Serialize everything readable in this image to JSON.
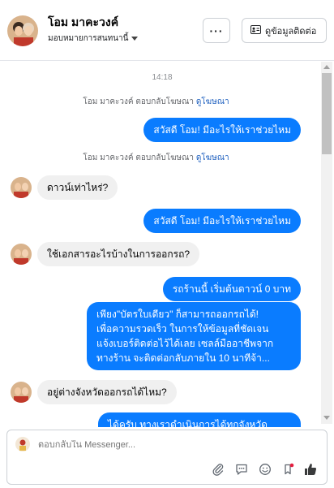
{
  "header": {
    "name": "โอม มาคะวงค์",
    "assign_label": "มอบหมายการสนทนานี้",
    "more_label": "···",
    "info_label": "ดูข้อมูลติดต่อ"
  },
  "thread": {
    "timestamp": "14:18",
    "reply_note_1": {
      "text": "โอม มาคะวงค์ ตอบกลับโฆษณา",
      "link": "ดูโฆษณา"
    },
    "reply_note_2": {
      "text": "โอม มาคะวงค์ ตอบกลับโฆษณา",
      "link": "ดูโฆษณา"
    },
    "outgoing_1": "สวัสดี โอม! มีอะไรให้เราช่วยไหม",
    "incoming_1": "ดาวน์เท่าไหร่?",
    "outgoing_2": "สวัสดี โอม! มีอะไรให้เราช่วยไหม",
    "incoming_2": "ใช้เอกสารอะไรบ้างในการออกรถ?",
    "outgoing_3": "รถร้านนี้ เริ่มต้นดาวน์ 0 บาท",
    "outgoing_4_lines": [
      "เพียง\"บัตรใบเดียว\" ก็สามารถออกรถได้!",
      "เพื่อความรวดเร็ว ในการให้ข้อมูลที่ชัดเจน",
      "แจ้งเบอร์ติดต่อไว้ได้เลย เซลล์มืออาชีพจาก",
      "ทางร้าน จะติดต่อกลับภายใน 10 นาทีจ้า..."
    ],
    "incoming_3": "อยู่ต่างจังหวัดออกรถได้ไหม?",
    "outgoing_5_partial": "ได้ครับ ทางเราดำเนินการได้ทุกจังหวัด"
  },
  "composer": {
    "placeholder": "ตอบกลับใน Messenger..."
  },
  "colors": {
    "outgoing_bubble": "#0a7cff",
    "incoming_bubble": "#f0f0f0",
    "link": "#1d5fbf"
  },
  "icons": [
    "paperclip-icon",
    "chat-bubble-icon",
    "emoji-icon",
    "bookmark-icon",
    "thumbs-up-icon"
  ]
}
